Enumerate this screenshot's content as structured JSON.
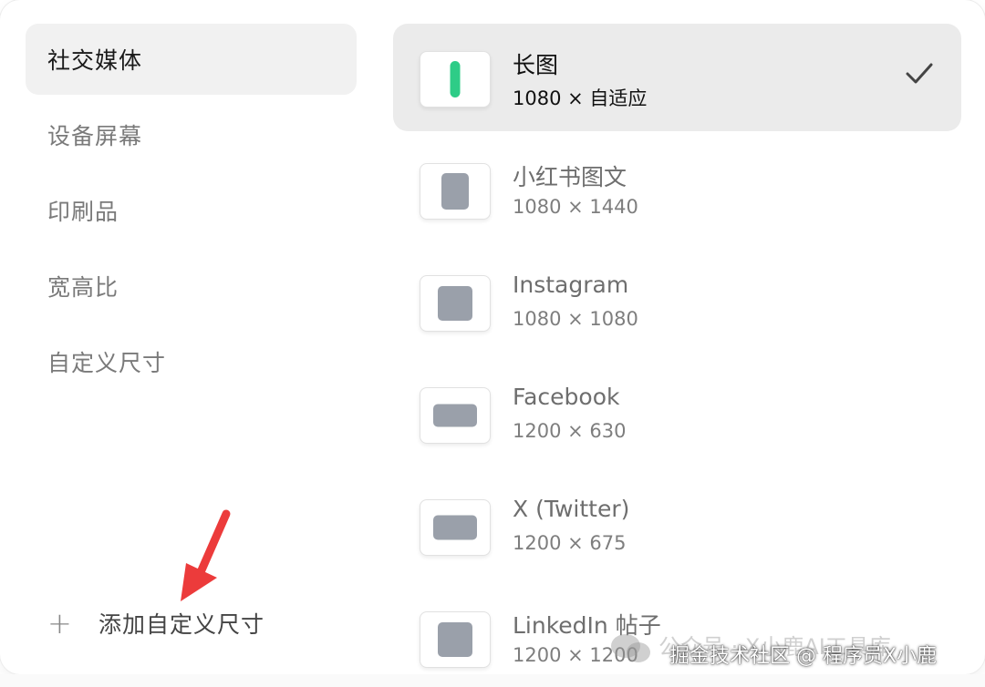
{
  "categories": [
    {
      "label": "社交媒体",
      "active": true
    },
    {
      "label": "设备屏幕",
      "active": false
    },
    {
      "label": "印刷品",
      "active": false
    },
    {
      "label": "宽高比",
      "active": false
    },
    {
      "label": "自定义尺寸",
      "active": false
    }
  ],
  "add_custom": {
    "icon": "plus-icon",
    "label": "添加自定义尺寸"
  },
  "presets": [
    {
      "name": "长图",
      "size": "1080 × 自适应",
      "selected": true,
      "icon": "long-image-icon",
      "accent": "#2ecc87"
    },
    {
      "name": "小红书图文",
      "size": "1080 × 1440",
      "selected": false,
      "icon": "portrait-icon"
    },
    {
      "name": "Instagram",
      "size": "1080 × 1080",
      "selected": false,
      "icon": "square-icon"
    },
    {
      "name": "Facebook",
      "size": "1200 × 630",
      "selected": false,
      "icon": "landscape-icon"
    },
    {
      "name": "X (Twitter)",
      "size": "1200 × 675",
      "selected": false,
      "icon": "landscape-icon"
    },
    {
      "name": "LinkedIn 帖子",
      "size": "1200 × 1200",
      "selected": false,
      "icon": "square-icon"
    }
  ],
  "watermark": {
    "back_text": "公众号 · X小鹿AI工具库",
    "front_text": "掘金技术社区 @ 程序员X小鹿"
  },
  "colors": {
    "selected_bg": "#ebebeb",
    "shape_gray": "#9aa0aa",
    "accent_green": "#2ecc87"
  }
}
